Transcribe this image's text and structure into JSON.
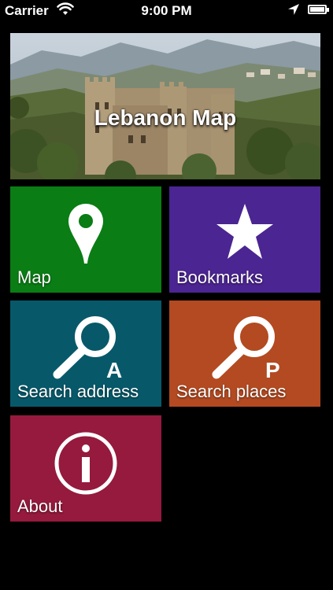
{
  "status_bar": {
    "carrier": "Carrier",
    "time": "9:00 PM"
  },
  "banner": {
    "title": "Lebanon Map"
  },
  "tiles": {
    "map": {
      "label": "Map",
      "color": "#0a7d14",
      "icon": "map-pin-icon"
    },
    "bookmarks": {
      "label": "Bookmarks",
      "color": "#4b2591",
      "icon": "star-icon"
    },
    "search_address": {
      "label": "Search address",
      "color": "#07596a",
      "icon": "magnifier-a-icon",
      "badge": "A"
    },
    "search_places": {
      "label": "Search places",
      "color": "#b34a21",
      "icon": "magnifier-p-icon",
      "badge": "P"
    },
    "about": {
      "label": "About",
      "color": "#951a3d",
      "icon": "info-icon"
    }
  }
}
